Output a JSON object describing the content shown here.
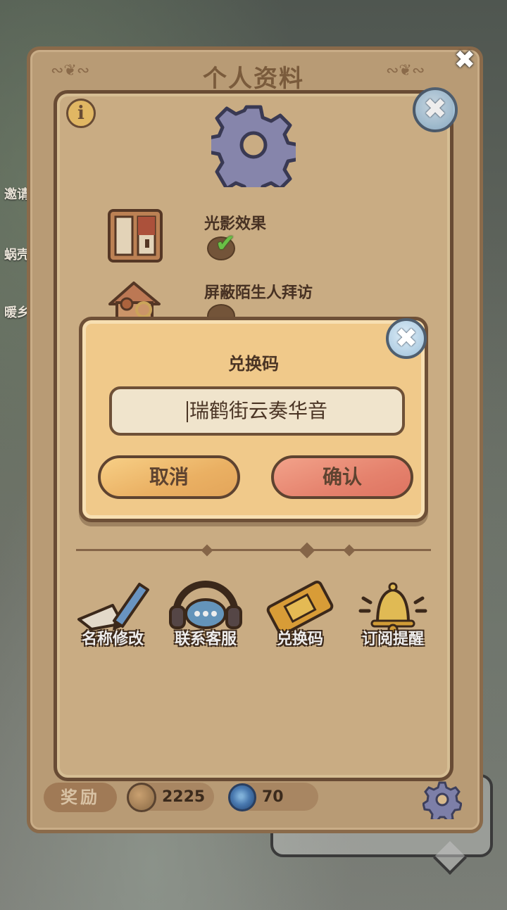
{
  "background": {
    "side_labels": [
      "邀请",
      "蜗壳",
      "暖乡"
    ]
  },
  "profile_panel": {
    "title": "个人资料",
    "close_glyph": "✖",
    "reward_label": "奖励",
    "coins": "2225",
    "gems": "70"
  },
  "settings": {
    "info_glyph": "i",
    "close_glyph": "✖",
    "options": [
      {
        "label": "光影效果",
        "checked": true
      },
      {
        "label": "屏蔽陌生人拜访",
        "checked": false
      }
    ],
    "tools": [
      {
        "label": "名称修改",
        "icon": "pencil-icon"
      },
      {
        "label": "联系客服",
        "icon": "headset-icon"
      },
      {
        "label": "兑换码",
        "icon": "ticket-icon"
      },
      {
        "label": "订阅提醒",
        "icon": "bell-icon"
      }
    ]
  },
  "redeem_dialog": {
    "title": "兑换码",
    "input_value": "瑞鹤街云奏华音",
    "cancel_label": "取消",
    "confirm_label": "确认",
    "close_glyph": "✖"
  },
  "colors": {
    "panel_bg": "#d7b98c",
    "panel_border": "#6e5037",
    "cancel_button": "#eab063",
    "confirm_button": "#e5826d",
    "check_green": "#6fcf4a"
  }
}
